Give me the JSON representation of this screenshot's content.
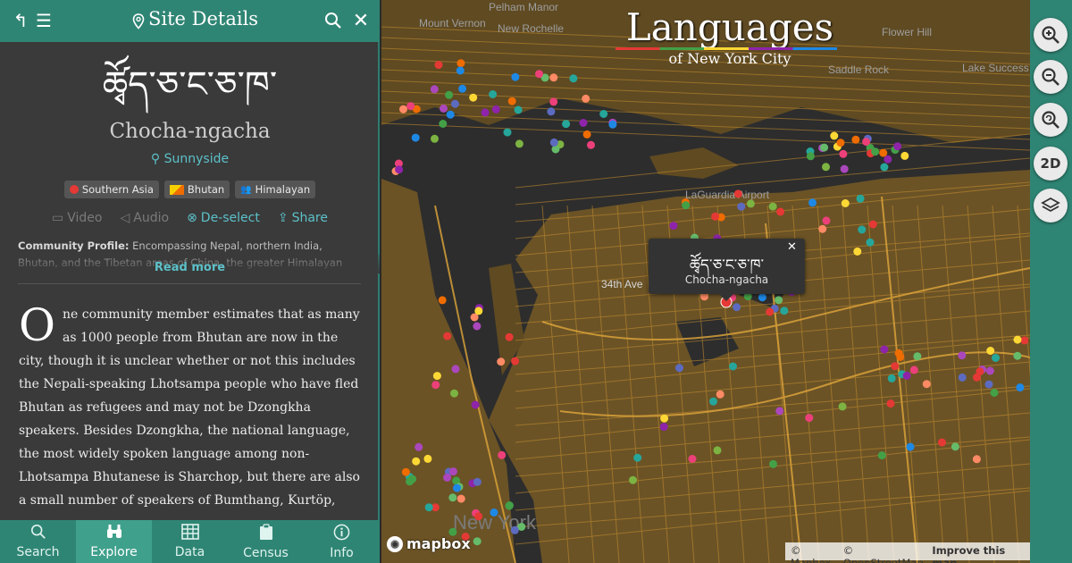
{
  "sidebar": {
    "title": "Site Details",
    "language_native": "ཚྭོད་ཅ་ང་ཅ་ཁ་",
    "language_roman": "Chocha-ngacha",
    "location": "Sunnyside",
    "tags": [
      "Southern Asia",
      "Bhutan",
      "Himalayan"
    ],
    "actions": {
      "video": "Video",
      "audio": "Audio",
      "deselect": "De-select",
      "share": "Share"
    },
    "profile_label": "Community Profile:",
    "profile_text": "Encompassing Nepal, northern India, Bhutan, and the Tibetan areas of China, the greater Himalayan region is a nexus of",
    "read_more": "Read more",
    "dropcap": "O",
    "body": "ne community member estimates that as many as 1000 people from Bhutan are now in the city, though it is unclear whether or not this includes the Nepali-speaking Lhotsampa people who have fled Bhutan as refugees and may not be Dzongkha speakers. Besides Dzongkha, the national language, the most widely spoken language among non-Lhotsampa Bhutanese is Sharchop, but there are also a small number of speakers of Bumthang, Kurtöp, Chocha-ngacha, and probably other languages of Bhutan. The largest"
  },
  "nav": [
    {
      "label": "Search",
      "icon": "search-icon"
    },
    {
      "label": "Explore",
      "icon": "binoculars-icon",
      "active": true
    },
    {
      "label": "Data",
      "icon": "table-icon"
    },
    {
      "label": "Census",
      "icon": "clipboard-icon"
    },
    {
      "label": "Info",
      "icon": "info-icon"
    }
  ],
  "map": {
    "title": "Languages",
    "subtitle": "of New York City",
    "labels": [
      "Mount Vernon",
      "New Rochelle",
      "Pelham Manor",
      "Flower Hill",
      "Lake Success",
      "Saddle Rock",
      "34th Ave",
      "LaGuardia Airport",
      "New York"
    ],
    "popup": {
      "native": "ཚྭོད་ཅ་ང་ཅ་ཁ་",
      "roman": "Chocha-ngacha",
      "close": "✕"
    },
    "logo": "mapbox",
    "attribution": [
      "© Mapbox",
      "© OpenStreetMap",
      "Improve this map"
    ]
  },
  "controls": [
    {
      "name": "zoom-in",
      "icon": "zoom-in-icon"
    },
    {
      "name": "zoom-out",
      "icon": "zoom-out-icon"
    },
    {
      "name": "reset-zoom",
      "icon": "zoom-reset-icon"
    },
    {
      "name": "view-2d",
      "label": "2D"
    },
    {
      "name": "layers",
      "icon": "layers-icon"
    }
  ],
  "colors": {
    "teal": "#2f8574",
    "teal_active": "#3fa08c",
    "link": "#5cc1c9",
    "land": "#6b5326",
    "road": "#c8902e"
  }
}
